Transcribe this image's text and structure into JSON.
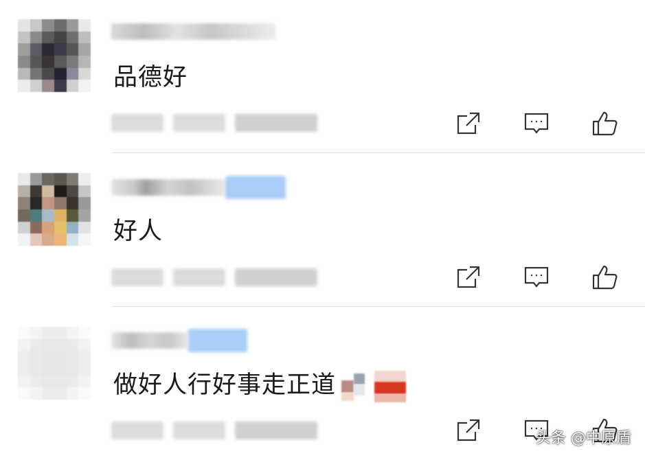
{
  "comments": [
    {
      "text": "品德好"
    },
    {
      "text": "好人"
    },
    {
      "text": "做好人行好事走正道"
    }
  ],
  "icons": [
    "share-icon",
    "reply-icon",
    "like-icon"
  ],
  "colors": {
    "text": "#1a1a1a",
    "divider": "#e3e3e3",
    "icon": "#333333",
    "badge": "#a9cdf7"
  },
  "watermark": "头条 @中原盾"
}
